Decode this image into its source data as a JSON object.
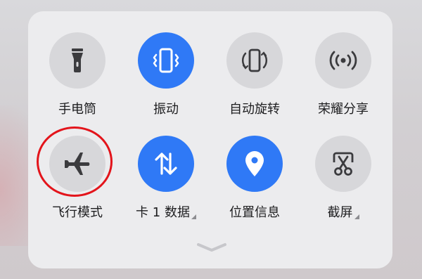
{
  "quick_settings": {
    "row1": [
      {
        "label": "手电筒",
        "icon": "flashlight-icon",
        "active": false
      },
      {
        "label": "振动",
        "icon": "vibrate-icon",
        "active": true
      },
      {
        "label": "自动旋转",
        "icon": "auto-rotate-icon",
        "active": false
      },
      {
        "label": "荣耀分享",
        "icon": "share-icon",
        "active": false
      }
    ],
    "row2": [
      {
        "label": "飞行模式",
        "icon": "airplane-icon",
        "active": false
      },
      {
        "label": "卡 1 数据",
        "icon": "mobile-data-icon",
        "active": true
      },
      {
        "label": "位置信息",
        "icon": "location-icon",
        "active": true
      },
      {
        "label": "截屏",
        "icon": "screenshot-icon",
        "active": false
      }
    ]
  },
  "colors": {
    "active": "#2f79f6",
    "inactive": "#d7d7da",
    "panel": "#ececee",
    "highlight_ring": "#e3141b"
  }
}
